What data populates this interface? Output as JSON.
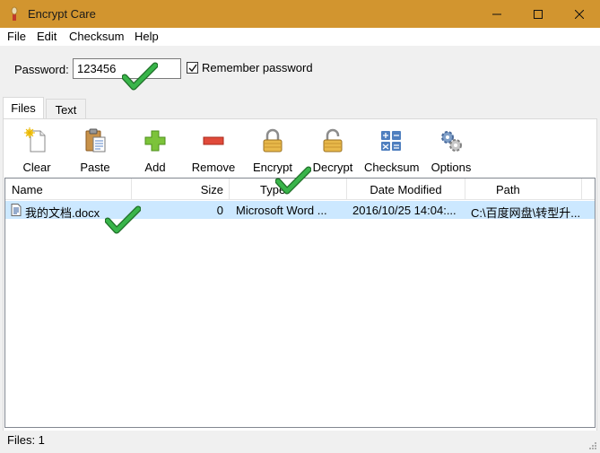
{
  "window": {
    "title": "Encrypt Care"
  },
  "menu": [
    "File",
    "Edit",
    "Checksum",
    "Help"
  ],
  "password": {
    "label": "Password:",
    "value": "123456"
  },
  "remember": {
    "label": "Remember password",
    "checked": true
  },
  "tabs": [
    "Files",
    "Text"
  ],
  "toolbar": [
    {
      "label": "Clear",
      "icon": "clear-icon"
    },
    {
      "label": "Paste",
      "icon": "paste-icon"
    },
    {
      "label": "Add",
      "icon": "add-icon"
    },
    {
      "label": "Remove",
      "icon": "remove-icon"
    },
    {
      "label": "Encrypt",
      "icon": "lock-icon"
    },
    {
      "label": "Decrypt",
      "icon": "unlock-icon"
    },
    {
      "label": "Checksum",
      "icon": "calculator-icon"
    },
    {
      "label": "Options",
      "icon": "gears-icon"
    }
  ],
  "columns": [
    "Name",
    "Size",
    "Type",
    "Date Modified",
    "Path"
  ],
  "rows": [
    {
      "name": "我的文档.docx",
      "size": "0",
      "type": "Microsoft Word ...",
      "date": "2016/10/25 14:04:...",
      "path": "C:\\百度网盘\\转型升..."
    }
  ],
  "status": "Files: 1",
  "colors": {
    "titlebar": "#d2952f",
    "selection": "#cce8ff",
    "checkmark": "#2e9e3a"
  }
}
